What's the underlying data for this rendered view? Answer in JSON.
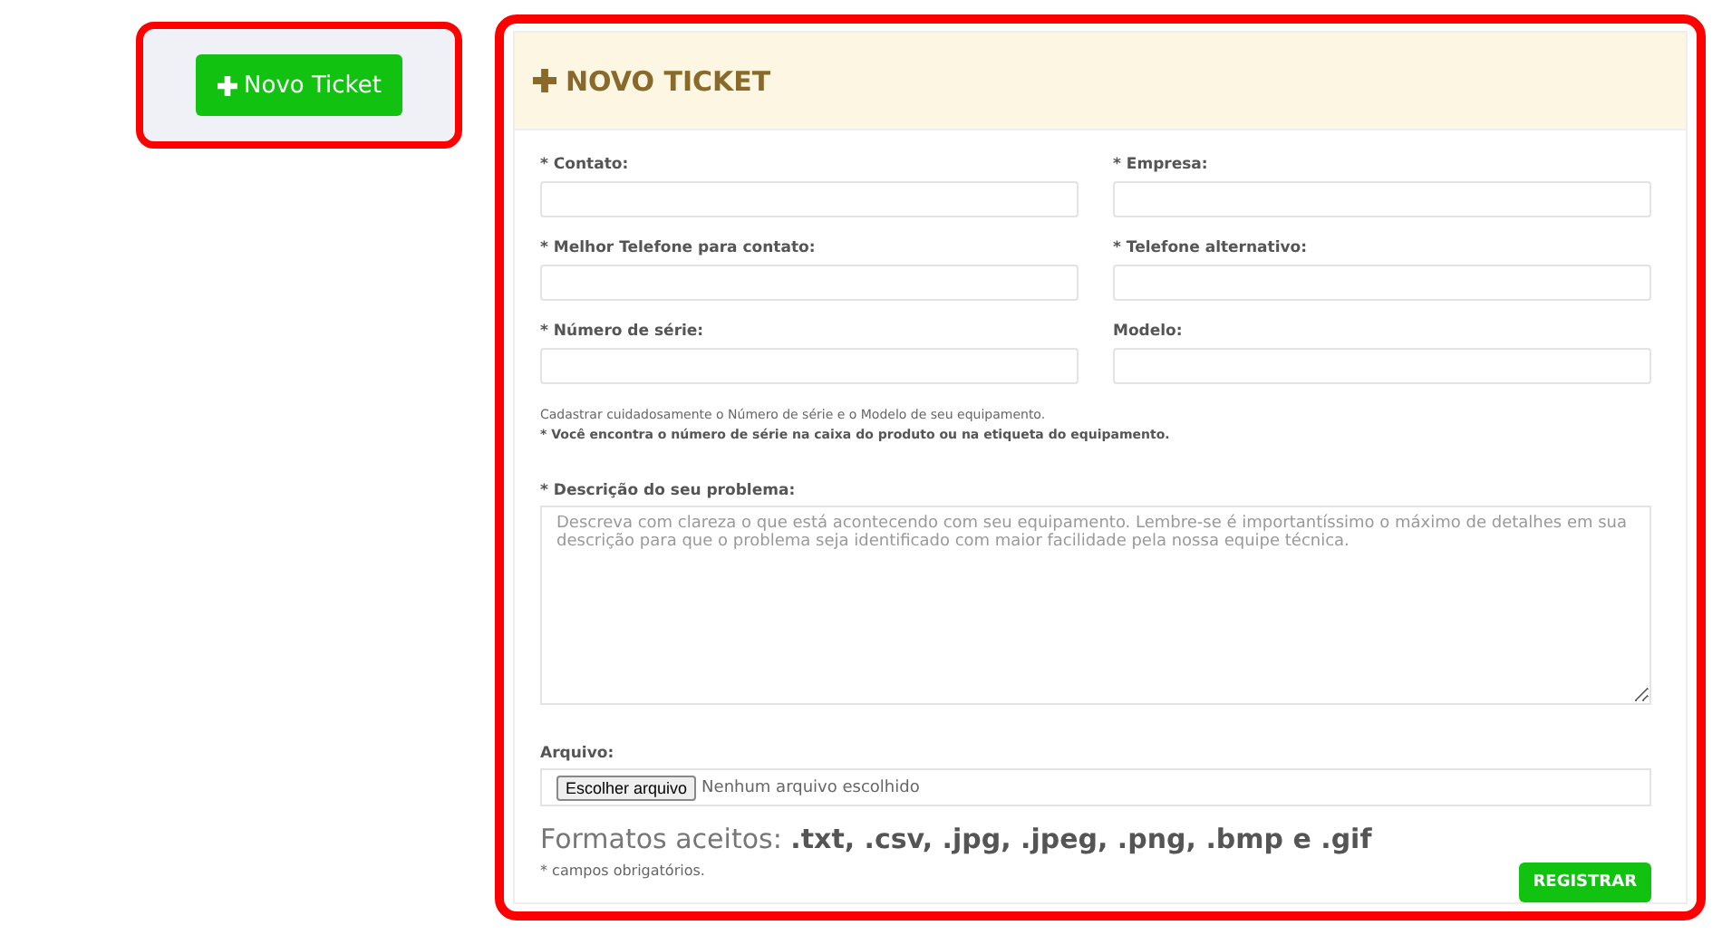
{
  "sidebar": {
    "new_ticket_button": "Novo Ticket"
  },
  "form": {
    "title": "NOVO TICKET",
    "fields": [
      {
        "label": "* Contato:"
      },
      {
        "label": "* Empresa:"
      },
      {
        "label": "* Melhor Telefone para contato:"
      },
      {
        "label": "* Telefone alternativo:"
      },
      {
        "label": "* Número de série:"
      },
      {
        "label": "Modelo:"
      }
    ],
    "help_text": "Cadastrar cuidadosamente o Número de série e o Modelo de seu equipamento.",
    "help_note": "* Você encontra o número de série na caixa do produto ou na etiqueta do equipamento.",
    "description": {
      "label": "* Descrição do seu problema:",
      "placeholder": "Descreva com clareza o que está acontecendo com seu equipamento. Lembre-se é importantíssimo o máximo de detalhes em sua descrição para que o problema seja identificado com maior facilidade pela nossa equipe técnica."
    },
    "file": {
      "label": "Arquivo:",
      "button": "Escolher arquivo",
      "status": "Nenhum arquivo escolhido"
    },
    "formats": "Formatos aceitos: **.txt, .csv, .jpg, .jpeg, .png, .bmp e .gif**",
    "required_note": "* campos obrigatórios.",
    "submit": "REGISTRAR"
  }
}
